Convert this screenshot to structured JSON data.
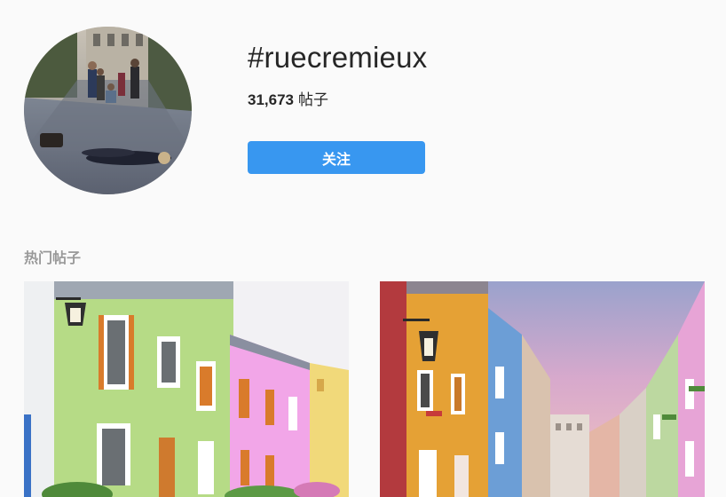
{
  "header": {
    "hashtag": "#ruecremieux",
    "post_count": "31,673",
    "post_count_unit": "帖子",
    "follow_label": "关注"
  },
  "top_posts": {
    "heading": "热门帖子"
  },
  "colors": {
    "accent": "#3897f0",
    "background": "#fafafa",
    "text": "#262626",
    "muted": "#999999"
  }
}
